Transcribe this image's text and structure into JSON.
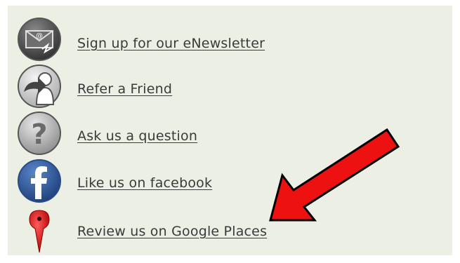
{
  "links": [
    {
      "label": "Sign up for our eNewsletter",
      "icon": "email-icon"
    },
    {
      "label": "Refer a Friend",
      "icon": "refer-friend-icon"
    },
    {
      "label": "Ask us a question",
      "icon": "question-icon"
    },
    {
      "label": "Like us on facebook",
      "icon": "facebook-icon"
    },
    {
      "label": "Review us on Google Places",
      "icon": "map-pin-icon"
    }
  ],
  "colors": {
    "panel_background": "#ecefe4",
    "link_text": "#3a3a3a",
    "arrow_fill": "#ee1111",
    "facebook_blue": "#2d5ea8",
    "pin_red": "#d40000"
  }
}
